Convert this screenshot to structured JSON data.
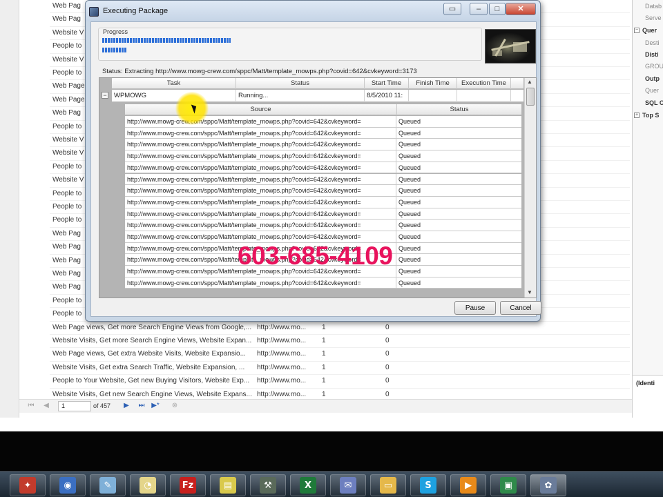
{
  "dialog": {
    "title": "Executing Package",
    "progress_label": "Progress",
    "status_text": "Status:  Extracting http://www.mowg-crew.com/sppc/Matt/template_mowps.php?covid=642&cvkeyword=3173",
    "buttons": {
      "pause": "Pause",
      "cancel": "Cancel"
    },
    "window_controls": {
      "restore": "▭",
      "minimize": "–",
      "maximize": "□",
      "close": "✕"
    }
  },
  "task_table": {
    "columns": [
      "Task",
      "Status",
      "Start Time",
      "Finish Time",
      "Execution Time"
    ],
    "row": {
      "task": "WPMOWG",
      "status": "Running...",
      "start_time": "8/5/2010 11:",
      "finish_time": "",
      "execution_time": ""
    },
    "expander": "−"
  },
  "source_table": {
    "columns": [
      "Source",
      "Status"
    ],
    "rows": [
      {
        "source": "http://www.mowg-crew.com/sppc/Matt/template_mowps.php?covid=642&cvkeyword=",
        "status": "Queued"
      },
      {
        "source": "http://www.mowg-crew.com/sppc/Matt/template_mowps.php?covid=642&cvkeyword=",
        "status": "Queued"
      },
      {
        "source": "http://www.mowg-crew.com/sppc/Matt/template_mowps.php?covid=642&cvkeyword=",
        "status": "Queued"
      },
      {
        "source": "http://www.mowg-crew.com/sppc/Matt/template_mowps.php?covid=642&cvkeyword=",
        "status": "Queued"
      },
      {
        "source": "http://www.mowg-crew.com/sppc/Matt/template_mowps.php?covid=642&cvkeyword=",
        "status": "Queued"
      },
      {
        "source": "http://www.mowg-crew.com/sppc/Matt/template_mowps.php?covid=642&cvkeyword=",
        "status": "Queued"
      },
      {
        "source": "http://www.mowg-crew.com/sppc/Matt/template_mowps.php?covid=642&cvkeyword=",
        "status": "Queued"
      },
      {
        "source": "http://www.mowg-crew.com/sppc/Matt/template_mowps.php?covid=642&cvkeyword=",
        "status": "Queued"
      },
      {
        "source": "http://www.mowg-crew.com/sppc/Matt/template_mowps.php?covid=642&cvkeyword=",
        "status": "Queued"
      },
      {
        "source": "http://www.mowg-crew.com/sppc/Matt/template_mowps.php?covid=642&cvkeyword=",
        "status": "Queued"
      },
      {
        "source": "http://www.mowg-crew.com/sppc/Matt/template_mowps.php?covid=642&cvkeyword=",
        "status": "Queued"
      },
      {
        "source": "http://www.mowg-crew.com/sppc/Matt/template_mowps.php?covid=642&cvkeyword=",
        "status": "Queued"
      },
      {
        "source": "http://www.mowg-crew.com/sppc/Matt/template_mowps.php?covid=642&cvkeyword=",
        "status": "Queued"
      },
      {
        "source": "http://www.mowg-crew.com/sppc/Matt/template_mowps.php?covid=642&cvkeyword=",
        "status": "Queued"
      },
      {
        "source": "http://www.mowg-crew.com/sppc/Matt/template_mowps.php?covid=642&cvkeyword=",
        "status": "Queued"
      }
    ]
  },
  "overlay": {
    "phone": "603-685-4109"
  },
  "background": {
    "rows": [
      {
        "title": "Web Pag",
        "url": "",
        "n1": "",
        "n2": ""
      },
      {
        "title": "Web Pag",
        "url": "",
        "n1": "",
        "n2": ""
      },
      {
        "title": "Website V",
        "url": "",
        "n1": "",
        "n2": ""
      },
      {
        "title": "People to",
        "url": "",
        "n1": "",
        "n2": ""
      },
      {
        "title": "Website V",
        "url": "",
        "n1": "",
        "n2": ""
      },
      {
        "title": "People to",
        "url": "",
        "n1": "",
        "n2": ""
      },
      {
        "title": "Web Page",
        "url": "",
        "n1": "",
        "n2": ""
      },
      {
        "title": "Web Page",
        "url": "",
        "n1": "",
        "n2": ""
      },
      {
        "title": "Web Pag",
        "url": "",
        "n1": "",
        "n2": ""
      },
      {
        "title": "People to",
        "url": "",
        "n1": "",
        "n2": ""
      },
      {
        "title": "Website V",
        "url": "",
        "n1": "",
        "n2": ""
      },
      {
        "title": "Website V",
        "url": "",
        "n1": "",
        "n2": ""
      },
      {
        "title": "People to",
        "url": "",
        "n1": "",
        "n2": ""
      },
      {
        "title": "Website V",
        "url": "",
        "n1": "",
        "n2": ""
      },
      {
        "title": "People to",
        "url": "",
        "n1": "",
        "n2": ""
      },
      {
        "title": "People to",
        "url": "",
        "n1": "",
        "n2": ""
      },
      {
        "title": "People to",
        "url": "",
        "n1": "",
        "n2": ""
      },
      {
        "title": "Web Pag",
        "url": "",
        "n1": "",
        "n2": ""
      },
      {
        "title": "Web Pag",
        "url": "",
        "n1": "",
        "n2": ""
      },
      {
        "title": "Web Pag",
        "url": "",
        "n1": "",
        "n2": ""
      },
      {
        "title": "Web Pag",
        "url": "",
        "n1": "",
        "n2": ""
      },
      {
        "title": "Web Pag",
        "url": "",
        "n1": "",
        "n2": ""
      },
      {
        "title": "People to",
        "url": "",
        "n1": "",
        "n2": ""
      },
      {
        "title": "People to",
        "url": "",
        "n1": "",
        "n2": ""
      },
      {
        "title": "Web Page views, Get more Search Engine Views from Google,...",
        "url": "http://www.mo...",
        "n1": "1",
        "n2": "0"
      },
      {
        "title": "Website Visits, Get more Search Engine Views, Website Expan...",
        "url": "http://www.mo...",
        "n1": "1",
        "n2": "0"
      },
      {
        "title": "Web Page views, Get extra Website Visits, Website Expansio...",
        "url": "http://www.mo...",
        "n1": "1",
        "n2": "0"
      },
      {
        "title": "Website Visits, Get extra Search Traffic, Website Expansion, ...",
        "url": "http://www.mo...",
        "n1": "1",
        "n2": "0"
      },
      {
        "title": "People to Your Website, Get new Buying Visitors, Website Exp...",
        "url": "http://www.mo...",
        "n1": "1",
        "n2": "0"
      },
      {
        "title": "Website Visits, Get new Search Engine Views, Website Expans...",
        "url": "http://www.mo...",
        "n1": "1",
        "n2": "0"
      }
    ],
    "right_panel": [
      {
        "label": "Datab",
        "bold": false
      },
      {
        "label": "Serve",
        "bold": false
      },
      {
        "label": "Quer",
        "bold": true,
        "toggle": "−"
      },
      {
        "label": "Desti",
        "bold": false
      },
      {
        "label": "Disti",
        "bold": true
      },
      {
        "label": "GROU",
        "bold": false
      },
      {
        "label": "Outp",
        "bold": true
      },
      {
        "label": "Quer",
        "bold": false
      },
      {
        "label": "SQL C",
        "bold": true
      },
      {
        "label": "Top S",
        "bold": true,
        "toggle": "+"
      }
    ],
    "right_bottom_label": "(Identi",
    "pager": {
      "page_input": "1",
      "of_label": "of 457"
    }
  },
  "taskbar": {
    "apps": [
      {
        "name": "photo-app",
        "glyph": "✦",
        "color": "#c23b2c"
      },
      {
        "name": "network-app",
        "glyph": "◉",
        "color": "#3b6fc2"
      },
      {
        "name": "notepad-app",
        "glyph": "✎",
        "color": "#7fb0d8"
      },
      {
        "name": "clock-app",
        "glyph": "◔",
        "color": "#e4d58a"
      },
      {
        "name": "filezilla-app",
        "glyph": "Fz",
        "color": "#c8201e"
      },
      {
        "name": "sticky-notes-app",
        "glyph": "▤",
        "color": "#d9c94c"
      },
      {
        "name": "tools-app",
        "glyph": "⚒",
        "color": "#5a6a5a"
      },
      {
        "name": "excel-app",
        "glyph": "X",
        "color": "#1f7a3a"
      },
      {
        "name": "mail-app",
        "glyph": "✉",
        "color": "#6d7fbf"
      },
      {
        "name": "folder-app",
        "glyph": "▭",
        "color": "#e5b84a"
      },
      {
        "name": "skype-app",
        "glyph": "S",
        "color": "#1ea1e0"
      },
      {
        "name": "media-app",
        "glyph": "▶",
        "color": "#e88a1a"
      },
      {
        "name": "monitor-app",
        "glyph": "▣",
        "color": "#2f8a4a"
      },
      {
        "name": "ssis-app",
        "glyph": "✿",
        "color": "#6a7c9a"
      }
    ]
  }
}
